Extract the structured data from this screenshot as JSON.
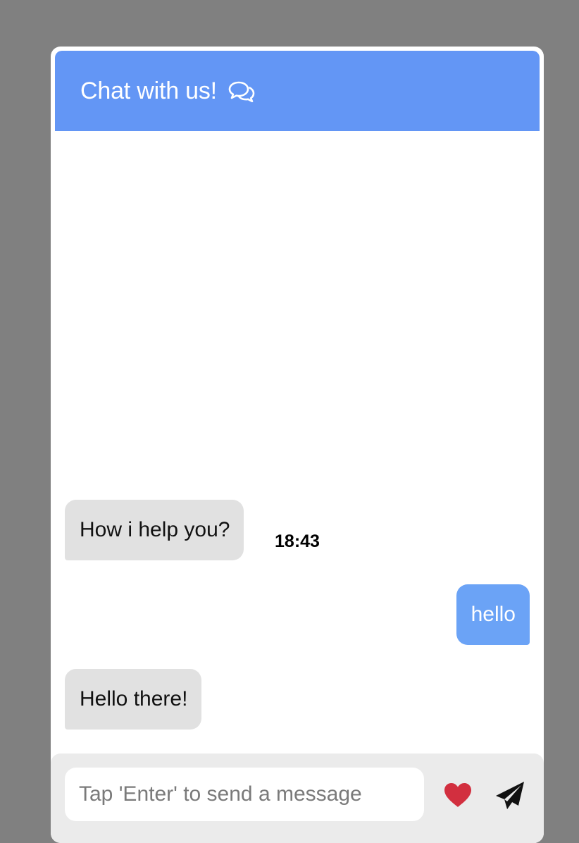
{
  "header": {
    "title": "Chat with us!",
    "icon": "chat-bubbles-icon",
    "background_color": "#6396f5"
  },
  "conversation": {
    "timestamp": "18:43",
    "messages": [
      {
        "sender": "bot",
        "text": "How i help you?"
      },
      {
        "sender": "user",
        "text": "hello"
      },
      {
        "sender": "bot",
        "text": "Hello there!"
      }
    ]
  },
  "composer": {
    "placeholder": "Tap 'Enter' to send a message",
    "value": "",
    "like_icon": "heart-icon",
    "send_icon": "paper-plane-icon"
  },
  "colors": {
    "page_background": "#808080",
    "incoming_bubble": "#e1e1e1",
    "outgoing_bubble": "#6ba3f6",
    "heart": "#d22f3f"
  }
}
